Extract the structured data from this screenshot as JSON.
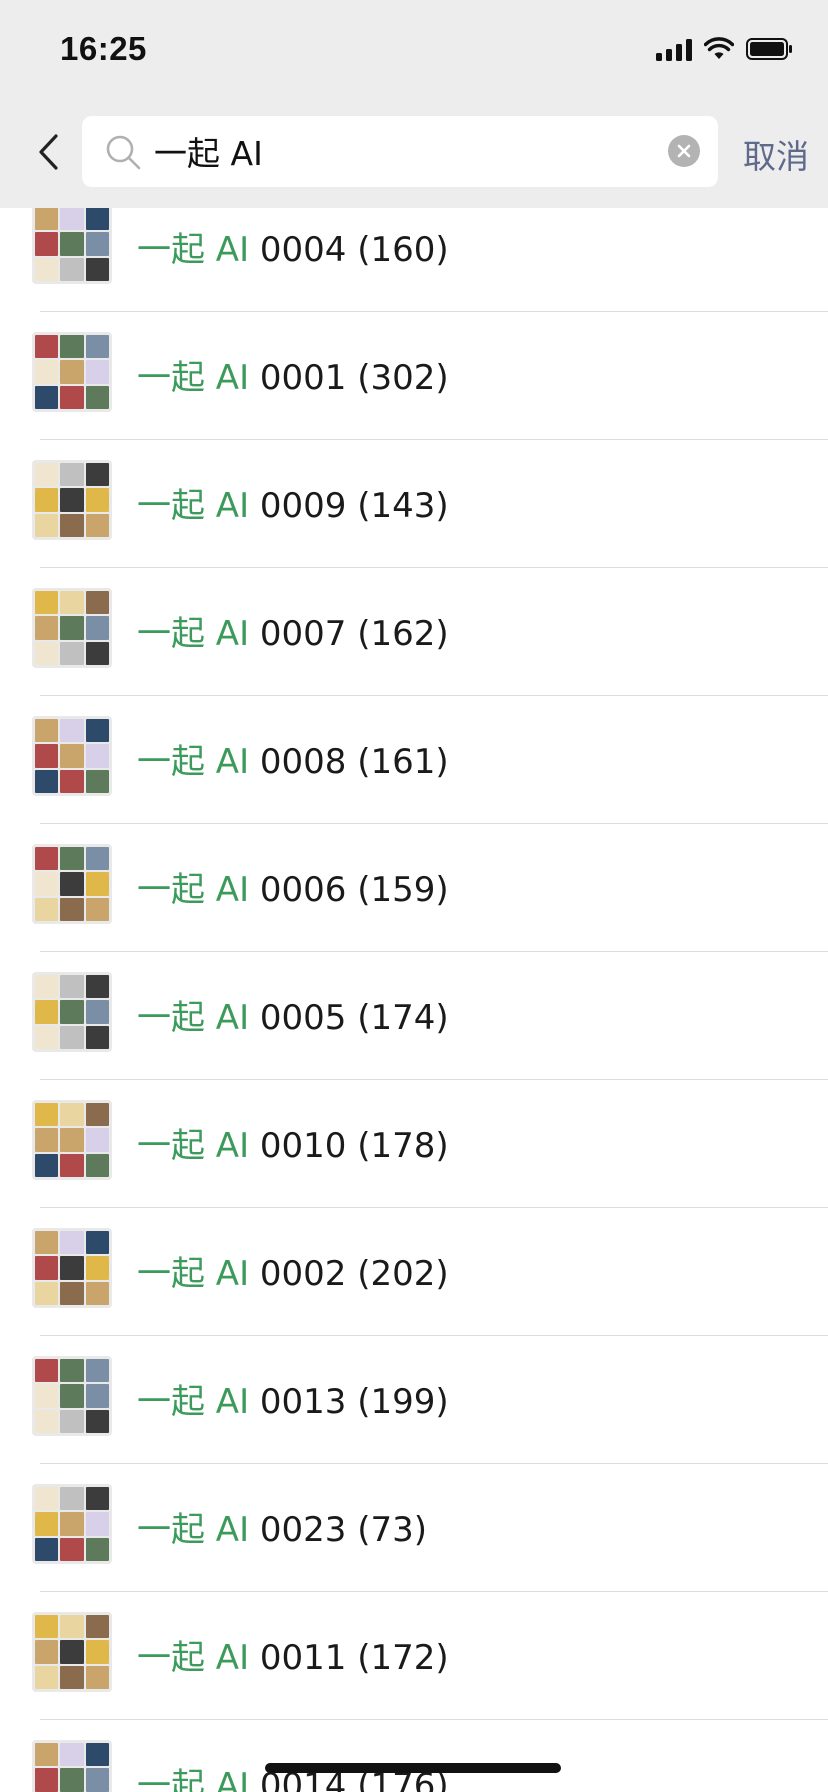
{
  "status_bar": {
    "time": "16:25"
  },
  "search": {
    "query": "一起 AI",
    "cancel_label": "取消"
  },
  "results": [
    {
      "match": "一起 AI",
      "rest": " 0004 (160)"
    },
    {
      "match": "一起 AI",
      "rest": " 0001 (302)"
    },
    {
      "match": "一起 AI",
      "rest": " 0009 (143)"
    },
    {
      "match": "一起 AI",
      "rest": " 0007 (162)"
    },
    {
      "match": "一起 AI",
      "rest": " 0008 (161)"
    },
    {
      "match": "一起 AI",
      "rest": " 0006 (159)"
    },
    {
      "match": "一起 AI",
      "rest": " 0005 (174)"
    },
    {
      "match": "一起 AI",
      "rest": " 0010 (178)"
    },
    {
      "match": "一起 AI",
      "rest": " 0002 (202)"
    },
    {
      "match": "一起 AI",
      "rest": " 0013 (199)"
    },
    {
      "match": "一起 AI",
      "rest": " 0023 (73)"
    },
    {
      "match": "一起 AI",
      "rest": " 0011 (172)"
    },
    {
      "match": "一起 AI",
      "rest": " 0014 (176)"
    }
  ],
  "colors": {
    "highlight": "#3d9a5a",
    "header_bg": "#ededed",
    "cancel": "#5f6a8a"
  },
  "avatar_palette": [
    "#c9a46b",
    "#7a8fa6",
    "#e8d5a0",
    "#b04a4a",
    "#3c3c3c",
    "#d8cfe8",
    "#f0e6d0",
    "#8a6b4e",
    "#5d7a5a",
    "#e0b84a",
    "#2e4a6b",
    "#c0c0c0"
  ]
}
